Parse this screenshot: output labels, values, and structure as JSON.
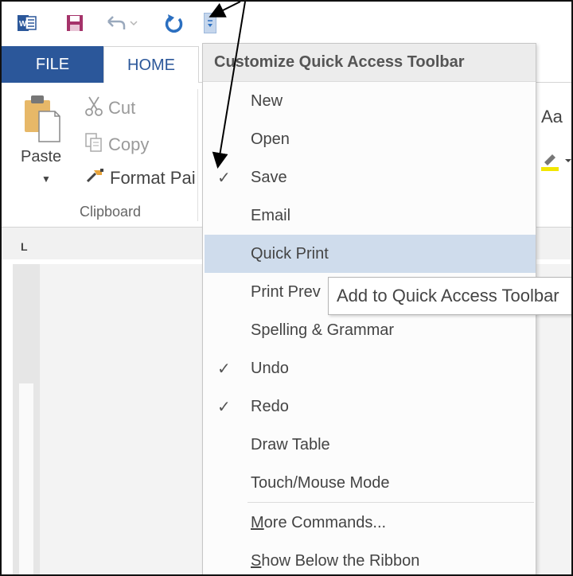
{
  "qat": {
    "word_icon": "word-icon",
    "save_icon": "save-icon",
    "undo_icon": "undo-icon",
    "redo_icon": "redo-icon",
    "customize_icon": "customize-dropdown-icon"
  },
  "tabs": {
    "file": "FILE",
    "home": "HOME"
  },
  "clipboard": {
    "paste": "Paste",
    "cut": "Cut",
    "copy": "Copy",
    "format_painter": "Format Pai",
    "group_label": "Clipboard"
  },
  "font_group": {
    "change_case": "Aa"
  },
  "ruler": {
    "tab_marker": "L",
    "vertical_mark": "1"
  },
  "menu": {
    "title": "Customize Quick Access Toolbar",
    "items": [
      {
        "label": "New",
        "checked": false
      },
      {
        "label": "Open",
        "checked": false
      },
      {
        "label": "Save",
        "checked": true
      },
      {
        "label": "Email",
        "checked": false
      },
      {
        "label": "Quick Print",
        "checked": false
      },
      {
        "label": "Print Prev",
        "checked": false
      },
      {
        "label": "Spelling & Grammar",
        "checked": false
      },
      {
        "label": "Undo",
        "checked": true
      },
      {
        "label": "Redo",
        "checked": true
      },
      {
        "label": "Draw Table",
        "checked": false
      },
      {
        "label": "Touch/Mouse Mode",
        "checked": false
      }
    ],
    "more_commands_u": "M",
    "more_commands_rest": "ore Commands...",
    "show_below_u": "S",
    "show_below_rest": "how Below the Ribbon"
  },
  "tooltip": {
    "text": "Add to Quick Access Toolbar"
  },
  "colors": {
    "file_tab": "#2b579a",
    "highlight": "#cfdcec",
    "save_icon": "#a5336a"
  }
}
